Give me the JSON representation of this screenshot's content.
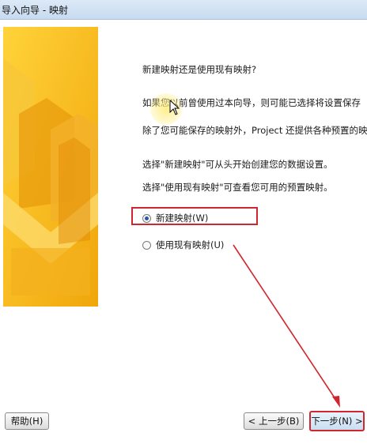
{
  "window": {
    "title": "导入向导 - 映射"
  },
  "content": {
    "question": "新建映射还是使用现有映射?",
    "line1": "如果您以前曾使用过本向导，则可能已选择将设置保存",
    "line2": "除了您可能保存的映射外，Project 还提供各种预置的映",
    "line3": "选择\"新建映射\"可从头开始创建您的数据设置。",
    "line4": "选择\"使用现有映射\"可查看您可用的预置映射。"
  },
  "options": [
    {
      "label": "新建映射(W)",
      "checked": true
    },
    {
      "label": "使用现有映射(U)",
      "checked": false
    }
  ],
  "buttons": {
    "help": "帮助(H)",
    "back": "< 上一步(B)",
    "next": "下一步(N) >"
  },
  "colors": {
    "accent": "#d0262f",
    "sidebar": "#f6b913"
  }
}
